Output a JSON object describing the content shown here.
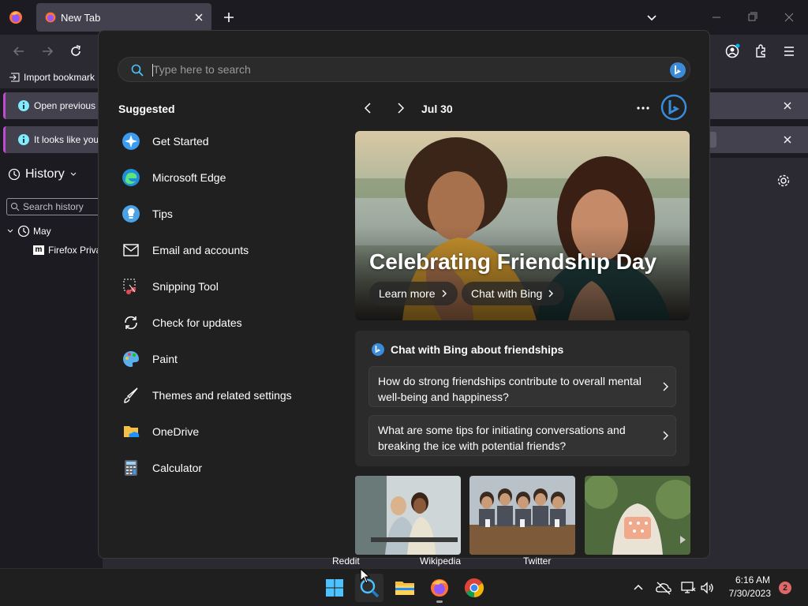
{
  "browser": {
    "tab_title": "New Tab",
    "bookmarks_import_label": "Import bookmark",
    "infobar_1_text": "Open previous",
    "infobar_2_text": "It looks like you"
  },
  "history_sidebar": {
    "title": "History",
    "search_placeholder": "Search history",
    "group_label": "May",
    "item_label": "Firefox Priva"
  },
  "start_menu": {
    "search_placeholder": "Type here to search",
    "suggested_title": "Suggested",
    "suggested": [
      {
        "label": "Get Started",
        "icon": "get-started-icon"
      },
      {
        "label": "Microsoft Edge",
        "icon": "edge-icon"
      },
      {
        "label": "Tips",
        "icon": "tips-icon"
      },
      {
        "label": "Email and accounts",
        "icon": "mail-icon"
      },
      {
        "label": "Snipping Tool",
        "icon": "snipping-tool-icon"
      },
      {
        "label": "Check for updates",
        "icon": "refresh-icon"
      },
      {
        "label": "Paint",
        "icon": "paint-icon"
      },
      {
        "label": "Themes and related settings",
        "icon": "brush-icon"
      },
      {
        "label": "OneDrive",
        "icon": "onedrive-icon"
      },
      {
        "label": "Calculator",
        "icon": "calculator-icon"
      }
    ],
    "date_label": "Jul 30",
    "hero": {
      "title": "Celebrating Friendship Day",
      "learn_more": "Learn more",
      "chat_with_bing": "Chat with Bing"
    },
    "chat_card": {
      "header": "Chat with Bing about friendships",
      "questions": [
        "How do strong friendships contribute to overall mental well-being and happiness?",
        "What are some tips for initiating conversations and breaking the ice with potential friends?"
      ]
    },
    "thumbnails": [
      "Reddit",
      "Wikipedia",
      "Twitter"
    ]
  },
  "taskbar": {
    "time": "6:16 AM",
    "date": "7/30/2023",
    "notification_count": "2"
  },
  "colors": {
    "accent_blue": "#0078d4",
    "infobar_accent": "#c04ad3",
    "start_bg": "#202020"
  }
}
